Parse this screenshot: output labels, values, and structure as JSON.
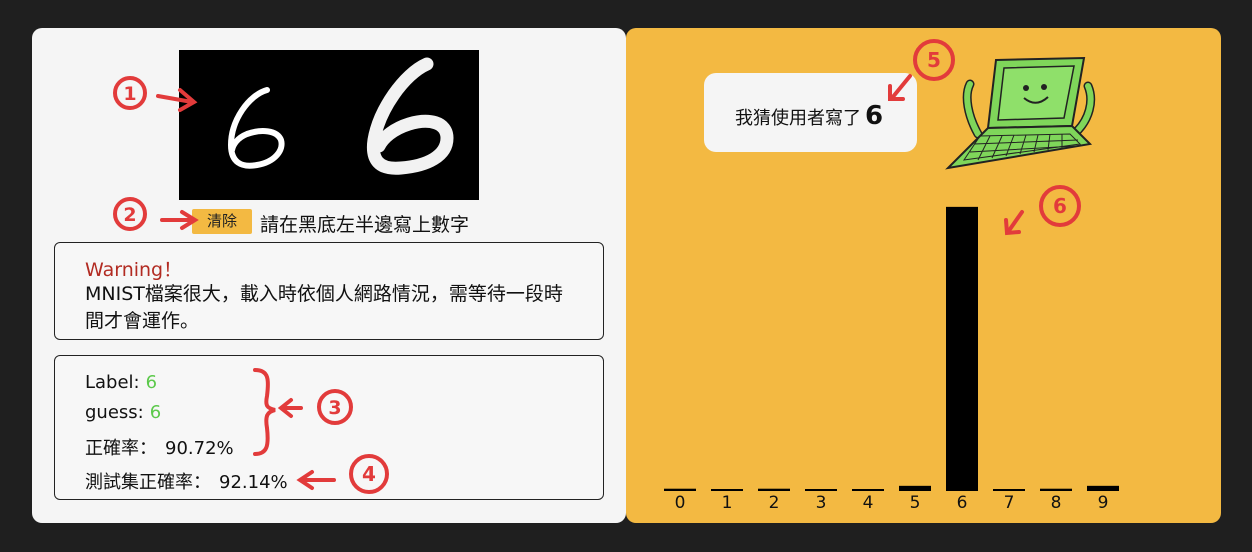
{
  "clear_button": "清除",
  "draw_hint": "請在黑底左半邊寫上數字",
  "warning": {
    "title": "Warning！",
    "text": "MNIST檔案很大，載入時依個人網路情況，需等待一段時間才會運作。"
  },
  "stats": {
    "label_key": "Label:",
    "label_value": "6",
    "guess_key": "guess:",
    "guess_value": "6",
    "acc_key": "正確率：",
    "acc_value": "90.72%",
    "test_acc_key": "測試集正確率：",
    "test_acc_value": "92.14%"
  },
  "annotations": [
    "1",
    "2",
    "3",
    "4",
    "5",
    "6"
  ],
  "bubble": {
    "text": "我猜使用者寫了",
    "digit": "6"
  },
  "colors": {
    "accent": "#f3b942",
    "value_green": "#5cc94b",
    "warning_red": "#b22b22",
    "annotation_red": "#e23b3b"
  },
  "chart_data": {
    "type": "bar",
    "categories": [
      "0",
      "1",
      "2",
      "3",
      "4",
      "5",
      "6",
      "7",
      "8",
      "9"
    ],
    "values": [
      0.008,
      0.005,
      0.008,
      0.005,
      0.005,
      0.018,
      0.99,
      0.005,
      0.008,
      0.018
    ],
    "ylim": [
      0,
      1
    ],
    "title": "",
    "xlabel": "",
    "ylabel": ""
  }
}
